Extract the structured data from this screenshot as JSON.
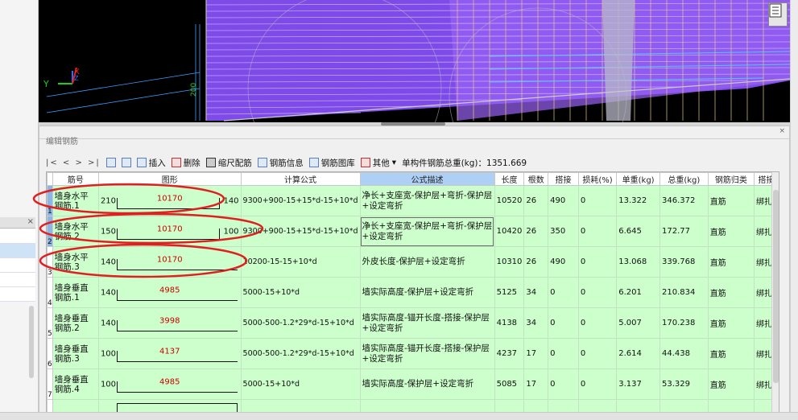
{
  "app": {
    "panel_title": "编辑钢筋"
  },
  "toolbar": {
    "nav_buttons": "|<  <  >  >|",
    "insert_label": "插入",
    "delete_label": "删除",
    "ruler_label": "缩尺配筋",
    "info_label": "钢筋信息",
    "library_label": "钢筋图库",
    "other_label": "其他",
    "total_weight_text": "单构件钢筋总重(kg)：1351.669"
  },
  "table": {
    "columns": [
      "筋号",
      "图形",
      "计算公式",
      "公式描述",
      "长度",
      "根数",
      "搭接",
      "损耗(%)",
      "单重(kg)",
      "总重(kg)",
      "钢筋归类",
      "搭接"
    ],
    "rows": [
      {
        "idx": "1",
        "name": "墙身水平钢筋.1",
        "left": "210",
        "value": "10170",
        "right": "140",
        "formula": "9300+900-15+15*d-15+10*d",
        "desc": "净长+支座宽-保护层+弯折-保护层+设定弯折",
        "length": "10520",
        "count": "26",
        "lap": "490",
        "loss": "0",
        "unit_weight": "13.322",
        "total_weight": "346.372",
        "category": "直筋",
        "lap_type": "绑扎"
      },
      {
        "idx": "2",
        "name": "墙身水平钢筋.2",
        "left": "150",
        "value": "10170",
        "right": "100",
        "formula": "9300+900-15+15*d-15+10*d",
        "desc": "净长+支座宽-保护层+弯折-保护层+设定弯折",
        "length": "10420",
        "count": "26",
        "lap": "350",
        "loss": "0",
        "unit_weight": "6.645",
        "total_weight": "172.77",
        "category": "直筋",
        "lap_type": "绑扎"
      },
      {
        "idx": "3",
        "name": "墙身水平钢筋.3",
        "left": "140",
        "value": "10170",
        "right": "",
        "formula": "10200-15-15+10*d",
        "desc": "外皮长度-保护层+设定弯折",
        "length": "10310",
        "count": "26",
        "lap": "490",
        "loss": "0",
        "unit_weight": "13.068",
        "total_weight": "339.768",
        "category": "直筋",
        "lap_type": "绑扎"
      },
      {
        "idx": "4",
        "name": "墙身垂直钢筋.1",
        "left": "140",
        "value": "4985",
        "right": "",
        "formula": "5000-15+10*d",
        "desc": "墙实际高度-保护层+设定弯折",
        "length": "5125",
        "count": "34",
        "lap": "0",
        "loss": "0",
        "unit_weight": "6.201",
        "total_weight": "210.834",
        "category": "直筋",
        "lap_type": "绑扎"
      },
      {
        "idx": "5",
        "name": "墙身垂直钢筋.2",
        "left": "140",
        "value": "3998",
        "right": "",
        "formula": "5000-500-1.2*29*d-15+10*d",
        "desc": "墙实际高度-锚开长度-搭接-保护层+设定弯折",
        "length": "4138",
        "count": "34",
        "lap": "0",
        "loss": "0",
        "unit_weight": "5.007",
        "total_weight": "170.238",
        "category": "直筋",
        "lap_type": "绑扎"
      },
      {
        "idx": "6",
        "name": "墙身垂直钢筋.3",
        "left": "100",
        "value": "4137",
        "right": "",
        "formula": "5000-500-1.2*29*d-15+10*d",
        "desc": "墙实际高度-锚开长度-搭接-保护层+设定弯折",
        "length": "4237",
        "count": "17",
        "lap": "0",
        "loss": "0",
        "unit_weight": "2.614",
        "total_weight": "44.438",
        "category": "直筋",
        "lap_type": "绑扎"
      },
      {
        "idx": "7",
        "name": "墙身垂直钢筋.4",
        "left": "100",
        "value": "4985",
        "right": "",
        "formula": "5000-15+10*d",
        "desc": "墙实际高度-保护层+设定弯折",
        "length": "5085",
        "count": "17",
        "lap": "0",
        "loss": "0",
        "unit_weight": "3.137",
        "total_weight": "53.329",
        "category": "直筋",
        "lap_type": "绑扎"
      }
    ]
  },
  "viewport": {
    "axis_y": "Y",
    "axis_x": "X",
    "axis_z": "Z",
    "dim_label": "200"
  },
  "colors": {
    "highlight_header": "#aed0f5",
    "row_bg": "#ccffcc",
    "figure_value": "#cc0000",
    "annotation": "#e02020",
    "viewport_bg": "#000000",
    "model_purple": "#8855ee"
  }
}
